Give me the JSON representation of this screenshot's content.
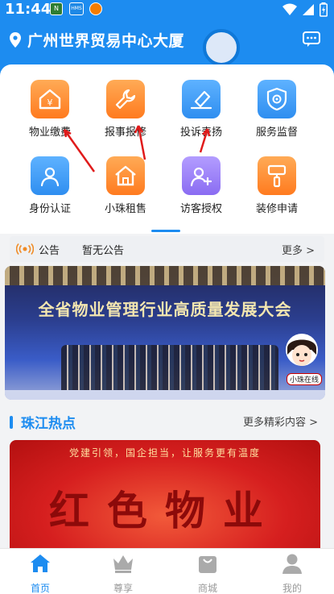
{
  "status_bar": {
    "time": "11:44",
    "icons": [
      "n-icon",
      "hms-icon",
      "app-icon",
      "wifi-icon",
      "signal-icon",
      "battery-icon"
    ]
  },
  "header": {
    "location": "广州世界贸易中心大厦",
    "location_icon": "location-pin-icon",
    "message_icon": "message-icon"
  },
  "services": [
    {
      "label": "物业缴费",
      "icon": "property-fee-icon",
      "color": "#ff7b1f"
    },
    {
      "label": "报事报修",
      "icon": "repair-wrench-icon",
      "color": "#ff7b1f"
    },
    {
      "label": "投诉表扬",
      "icon": "complaint-praise-icon",
      "color": "#2f8ef0"
    },
    {
      "label": "服务监督",
      "icon": "service-supervision-icon",
      "color": "#2f8ef0"
    },
    {
      "label": "身份认证",
      "icon": "identity-verify-icon",
      "color": "#2f8ef0"
    },
    {
      "label": "小珠租售",
      "icon": "rent-sell-house-icon",
      "color": "#ff7b1f"
    },
    {
      "label": "访客授权",
      "icon": "visitor-authorize-icon",
      "color": "#8a6cf2"
    },
    {
      "label": "装修申请",
      "icon": "decoration-brush-icon",
      "color": "#ff7b1f"
    }
  ],
  "notice": {
    "label": "公告",
    "text": "暂无公告",
    "more": "更多 >"
  },
  "banner": {
    "title": "全省物业管理行业高质量发展大会",
    "mascot_tag": "小珠在线"
  },
  "hot_section": {
    "title": "珠江热点",
    "more": "更多精彩内容 >"
  },
  "news_banner": {
    "slogan": "党建引领，国企担当，让服务更有温度",
    "headline": "红色物业"
  },
  "tabs": [
    {
      "label": "首页",
      "icon": "home-icon",
      "active": true
    },
    {
      "label": "尊享",
      "icon": "crown-icon",
      "active": false
    },
    {
      "label": "商城",
      "icon": "shop-bag-icon",
      "active": false
    },
    {
      "label": "我的",
      "icon": "profile-icon",
      "active": false
    }
  ],
  "colors": {
    "primary": "#1d8cf0",
    "annotation_arrow": "#e01b1b"
  }
}
